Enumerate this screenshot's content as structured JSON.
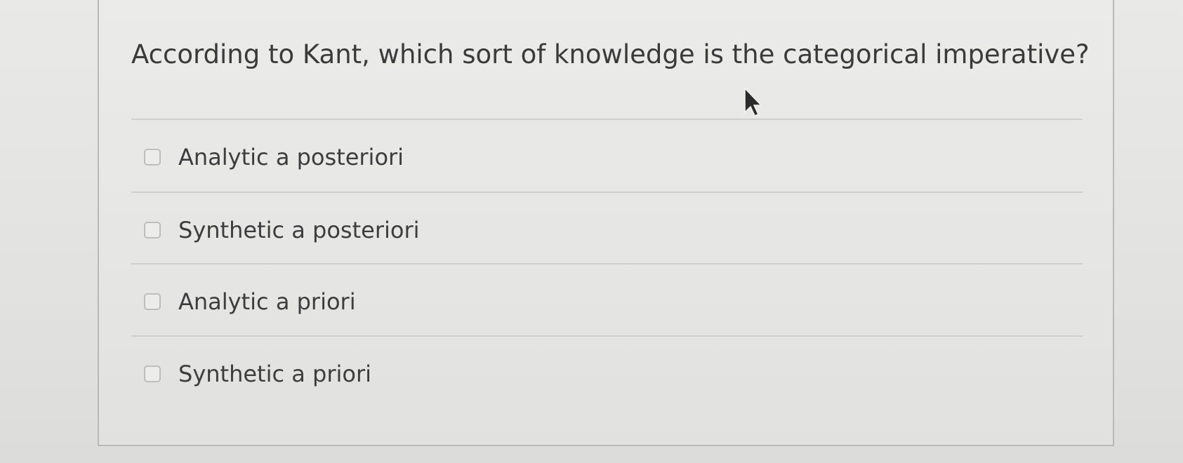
{
  "question": {
    "text": "According to Kant, which sort of knowledge is the categorical imperative?"
  },
  "options": [
    {
      "label": "Analytic a posteriori",
      "checked": false
    },
    {
      "label": "Synthetic a posteriori",
      "checked": false
    },
    {
      "label": "Analytic a priori",
      "checked": false
    },
    {
      "label": "Synthetic a priori",
      "checked": false
    }
  ],
  "icons": {
    "checkbox": "checkbox-icon",
    "cursor": "mouse-pointer-icon"
  },
  "colors": {
    "text": "#3a3a3c",
    "divider": "#cfcfcd",
    "checkbox_border": "#bdbdbb"
  }
}
